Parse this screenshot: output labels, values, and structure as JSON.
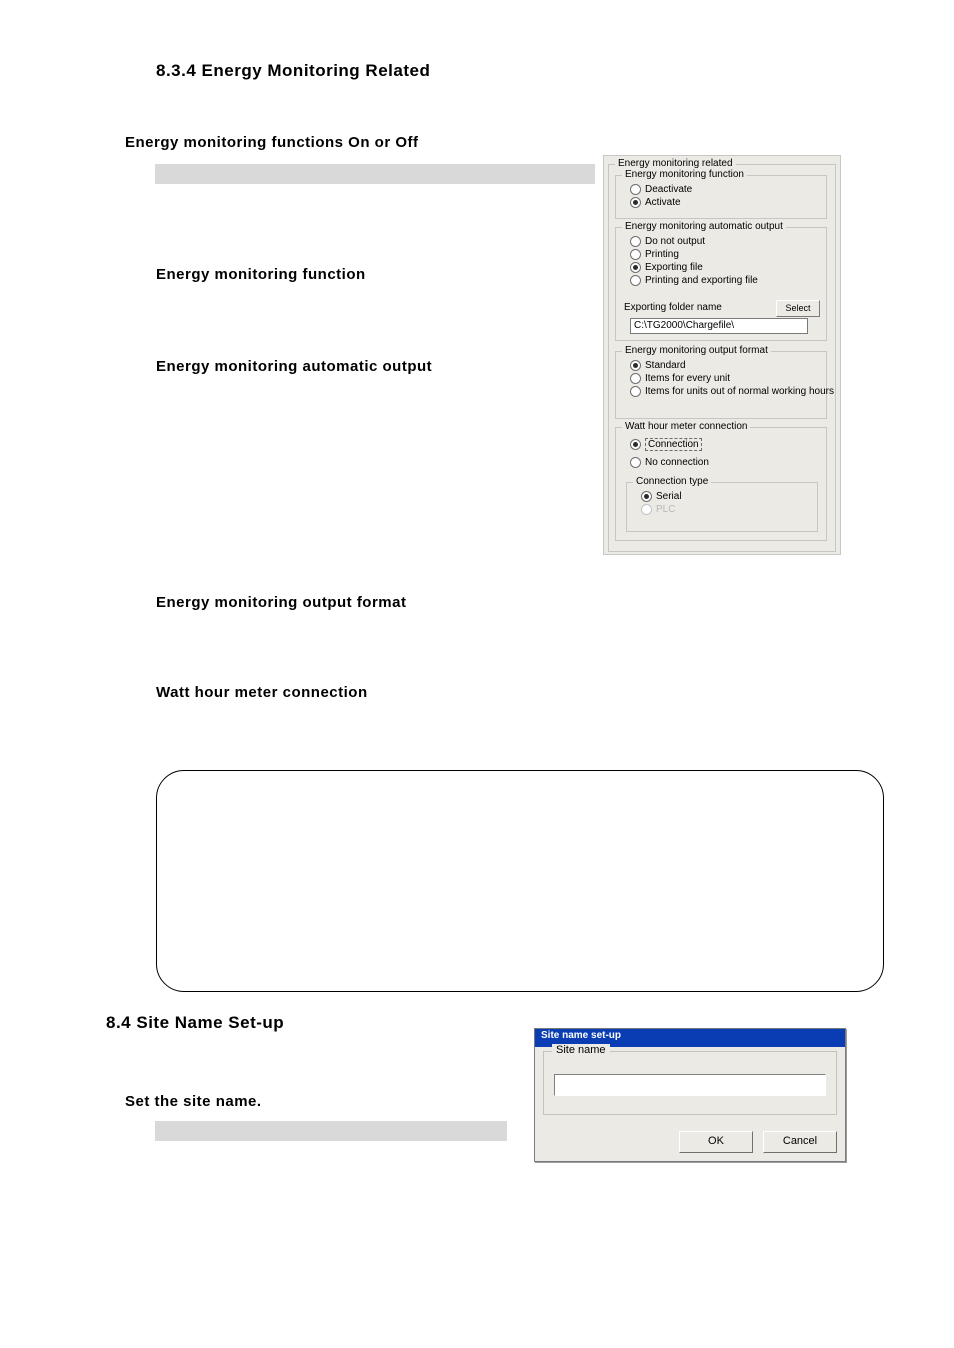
{
  "section834": {
    "title": "8.3.4  Energy Monitoring Related",
    "heading": "Energy monitoring functions On or Off",
    "labels": {
      "function": "Energy monitoring function",
      "auto_output": "Energy monitoring automatic output",
      "output_format": "Energy monitoring output format",
      "whm_connection": "Watt hour meter connection"
    }
  },
  "panel": {
    "outer_legend": "Energy monitoring related",
    "func": {
      "legend": "Energy monitoring function",
      "deactivate": "Deactivate",
      "activate": "Activate"
    },
    "auto": {
      "legend": "Energy monitoring automatic output",
      "do_not_output": "Do not output",
      "printing": "Printing",
      "exporting_file": "Exporting file",
      "printing_exporting": "Printing and exporting file",
      "folder_label": "Exporting folder name",
      "select_btn": "Select",
      "folder_value": "C:\\TG2000\\Chargefile\\"
    },
    "format": {
      "legend": "Energy monitoring output format",
      "standard": "Standard",
      "items_every_unit": "Items for every unit",
      "items_out_normal": "Items for units out of normal working hours"
    },
    "whm": {
      "legend": "Watt hour meter connection",
      "connection": "Connection",
      "no_connection": "No connection",
      "type_legend": "Connection type",
      "serial": "Serial",
      "plc": "PLC"
    }
  },
  "section84": {
    "title": "8.4   Site Name Set-up",
    "heading": "Set the site name."
  },
  "dialog": {
    "title": "Site name set-up",
    "group_legend": "Site name",
    "input_value": "",
    "ok": "OK",
    "cancel": "Cancel"
  }
}
